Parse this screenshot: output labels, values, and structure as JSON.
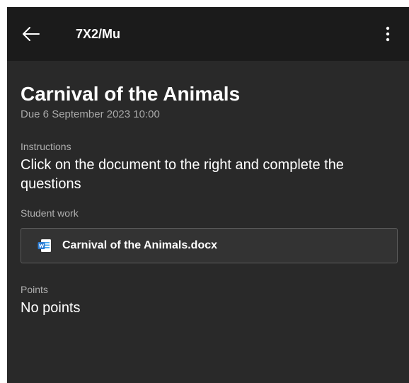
{
  "header": {
    "title": "7X2/Mu",
    "back_icon": "arrow-left-icon",
    "more_icon": "more-vertical-icon"
  },
  "assignment": {
    "title": "Carnival of the Animals",
    "due": "Due 6 September 2023 10:00"
  },
  "instructions": {
    "label": "Instructions",
    "text": "Click on the document to the right and complete the questions"
  },
  "student_work": {
    "label": "Student work",
    "file": {
      "name": "Carnival of the Animals.docx",
      "icon": "word-document-icon"
    }
  },
  "points": {
    "label": "Points",
    "value": "No points"
  },
  "colors": {
    "background": "#292929",
    "appbar": "#1b1b1b",
    "word_blue": "#2b7cd3"
  }
}
